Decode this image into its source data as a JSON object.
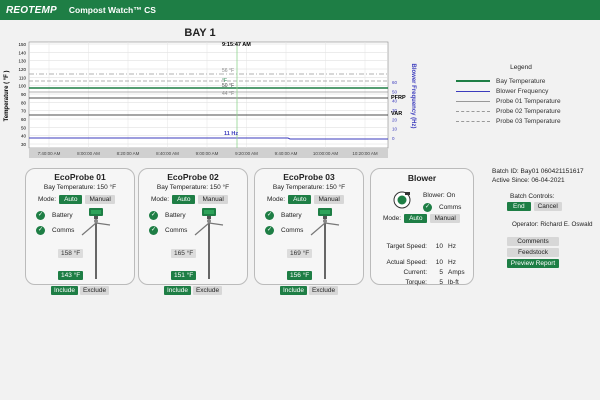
{
  "app": {
    "brand": "REOTEMP",
    "title": "Compost Watch™ CS"
  },
  "chart": {
    "title": "BAY 1",
    "cursor_time": "9:15:47 AM",
    "y_left_label": "Temperature ( °F )",
    "y_left_ticks": [
      "150",
      "140",
      "130",
      "120",
      "110",
      "100",
      "90",
      "80",
      "70",
      "60",
      "50",
      "40",
      "30"
    ],
    "y_right_label": "Blower Frequency (Hz)",
    "y_right_ticks": [
      "60",
      "50",
      "40",
      "30",
      "20",
      "10",
      "0"
    ],
    "x_ticks": [
      "7:40:00 AM",
      "8:00:00 AM",
      "8:20:00 AM",
      "8:40:00 AM",
      "9:00:00 AM",
      "9:20:00 AM",
      "9:40:00 AM",
      "10:00:00 AM",
      "10:20:00 AM"
    ],
    "readouts": {
      "probe3": "56 °F",
      "probe2": "50 °F",
      "bay": "°F",
      "probe1": "44 °F",
      "blower": "11 Hz"
    },
    "pfrp": "PFRP",
    "var": "VAR"
  },
  "legend": {
    "title": "Legend",
    "items": [
      {
        "label": "Bay Temperature",
        "color": "#1e7e45",
        "style": "solid-thick"
      },
      {
        "label": "Blower Frequency",
        "color": "#3b3bbd",
        "style": "solid"
      },
      {
        "label": "Probe 01 Temperature",
        "color": "#999999",
        "style": "solid"
      },
      {
        "label": "Probe 02 Temperature",
        "color": "#999999",
        "style": "dashed"
      },
      {
        "label": "Probe 03 Temperature",
        "color": "#999999",
        "style": "dash-dot"
      }
    ]
  },
  "probes": [
    {
      "name": "EcoProbe 01",
      "bay_temp": "Bay Temperature: 150 °F",
      "mode_label": "Mode:",
      "auto": "Auto",
      "manual": "Manual",
      "battery": "Battery",
      "comms": "Comms",
      "upper": "158 °F",
      "lower": "143 °F",
      "include": "Include",
      "exclude": "Exclude"
    },
    {
      "name": "EcoProbe 02",
      "bay_temp": "Bay Temperature: 150 °F",
      "mode_label": "Mode:",
      "auto": "Auto",
      "manual": "Manual",
      "battery": "Battery",
      "comms": "Comms",
      "upper": "165 °F",
      "lower": "151 °F",
      "include": "Include",
      "exclude": "Exclude"
    },
    {
      "name": "EcoProbe 03",
      "bay_temp": "Bay Temperature: 150 °F",
      "mode_label": "Mode:",
      "auto": "Auto",
      "manual": "Manual",
      "battery": "Battery",
      "comms": "Comms",
      "upper": "169 °F",
      "lower": "156 °F",
      "include": "Include",
      "exclude": "Exclude"
    }
  ],
  "blower": {
    "title": "Blower",
    "status": "Blower: On",
    "comms": "Comms",
    "mode_label": "Mode:",
    "auto": "Auto",
    "manual": "Manual",
    "target_label": "Target Speed:",
    "target_value": "10",
    "target_unit": "Hz",
    "actual_label": "Actual Speed:",
    "actual_value": "10",
    "actual_unit": "Hz",
    "current_label": "Current:",
    "current_value": "5",
    "current_unit": "Amps",
    "torque_label": "Torque:",
    "torque_value": "5",
    "torque_unit": "lb-ft"
  },
  "batch": {
    "id": "Batch ID: Bay01 060421151617",
    "active_since": "Active Since: 06-04-2021",
    "controls_label": "Batch Controls:",
    "end": "End",
    "cancel": "Cancel",
    "operator": "Operator: Richard E. Oswald",
    "comments": "Comments",
    "feedstock": "Feedstock",
    "preview": "Preview Report"
  },
  "colors": {
    "accent": "#1e7e45",
    "blower": "#3b3bbd"
  }
}
